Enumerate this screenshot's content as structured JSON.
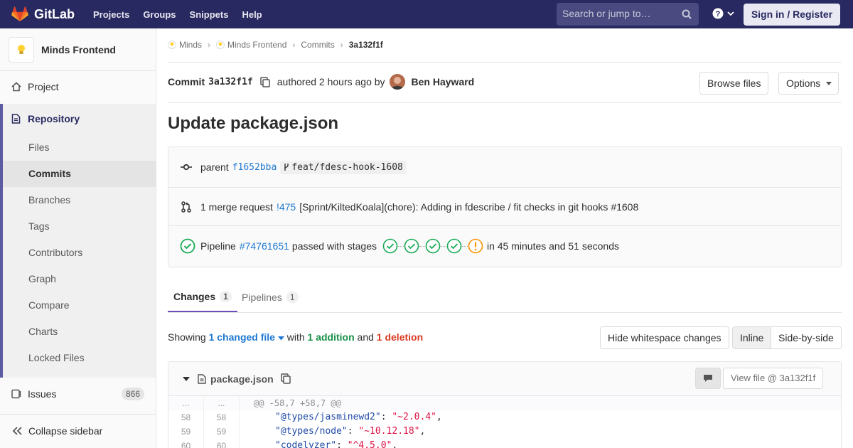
{
  "topnav": {
    "brand": "GitLab",
    "links": [
      "Projects",
      "Groups",
      "Snippets",
      "Help"
    ],
    "search_placeholder": "Search or jump to…",
    "signin_label": "Sign in / Register"
  },
  "sidebar": {
    "project_name": "Minds Frontend",
    "project_item": "Project",
    "repository_item": "Repository",
    "repository_sub": [
      "Files",
      "Commits",
      "Branches",
      "Tags",
      "Contributors",
      "Graph",
      "Compare",
      "Charts",
      "Locked Files"
    ],
    "issues_item": "Issues",
    "issues_count": "866",
    "collapse_label": "Collapse sidebar"
  },
  "breadcrumb": [
    "Minds",
    "Minds Frontend",
    "Commits",
    "3a132f1f"
  ],
  "commit": {
    "label": "Commit",
    "sha": "3a132f1f",
    "authored": "authored 2 hours ago by",
    "author": "Ben Hayward",
    "browse_files": "Browse files",
    "options": "Options",
    "title": "Update package.json"
  },
  "info": {
    "parent_label": "parent",
    "parent_sha": "f1652bba",
    "parent_branch": "feat/fdesc-hook-1608",
    "mr_count_text": "1 merge request",
    "mr_ref": "!475",
    "mr_title": "[Sprint/KiltedKoala](chore): Adding in fdescribe / fit checks in git hooks #1608",
    "pipeline_label": "Pipeline",
    "pipeline_ref": "#74761651",
    "pipeline_status": "passed with stages",
    "pipeline_duration": "in 45 minutes and 51 seconds"
  },
  "tabs": [
    {
      "label": "Changes",
      "count": "1"
    },
    {
      "label": "Pipelines",
      "count": "1"
    }
  ],
  "diffstats": {
    "showing": "Showing",
    "changed_files": "1 changed file",
    "with": "with",
    "additions": "1 addition",
    "and": "and",
    "deletions": "1 deletion",
    "hide_whitespace": "Hide whitespace changes",
    "inline": "Inline",
    "side_by_side": "Side-by-side"
  },
  "file": {
    "name": "package.json",
    "view_file": "View file @ 3a132f1f"
  },
  "diff": {
    "hunk_old": "...",
    "hunk_new": "...",
    "hunk_text": "@@ -58,7 +58,7 @@",
    "lines": [
      {
        "old": "58",
        "new": "58",
        "key": "\"@types/jasminewd2\"",
        "val": "\"~2.0.4\""
      },
      {
        "old": "59",
        "new": "59",
        "key": "\"@types/node\"",
        "val": "\"~10.12.18\""
      },
      {
        "old": "60",
        "new": "60",
        "key": "\"codelyzer\"",
        "val": "\"^4.5.0\""
      }
    ]
  },
  "colors": {
    "nav_bg": "#292961",
    "accent": "#6b4fbb",
    "link": "#1f78d1",
    "success": "#1aaa55",
    "warning": "#fc9403"
  }
}
